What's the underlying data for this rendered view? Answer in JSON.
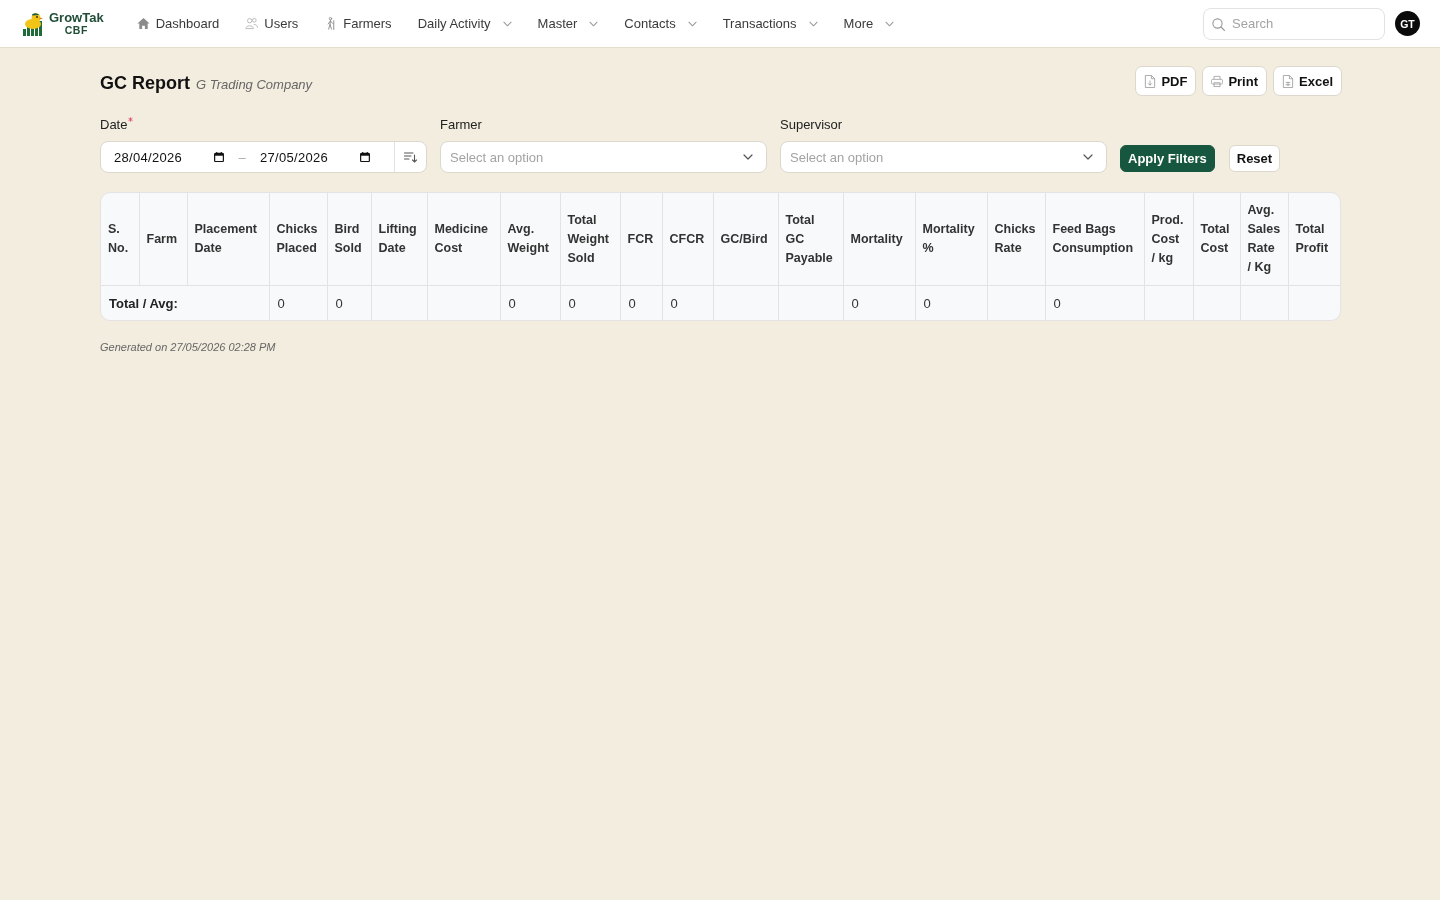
{
  "navbar": {
    "brand": {
      "name": "GrowTak",
      "tagline": "CBF"
    },
    "items": [
      {
        "label": "Dashboard",
        "kind": "link"
      },
      {
        "label": "Users",
        "kind": "link"
      },
      {
        "label": "Farmers",
        "kind": "link"
      },
      {
        "label": "Daily Activity",
        "kind": "menu"
      },
      {
        "label": "Master",
        "kind": "menu"
      },
      {
        "label": "Contacts",
        "kind": "menu"
      },
      {
        "label": "Transactions",
        "kind": "menu"
      },
      {
        "label": "More",
        "kind": "menu"
      }
    ],
    "search": {
      "placeholder": "Search"
    },
    "avatar": "GT"
  },
  "page": {
    "title": "GC Report",
    "subtitle": "G Trading Company",
    "exports": [
      "PDF",
      "Print",
      "Excel"
    ]
  },
  "filters": [
    {
      "kind": "date_range",
      "label": "Date",
      "required": true,
      "from": "28/04/2026",
      "separator": "–",
      "to": "27/05/2026"
    },
    {
      "kind": "select",
      "label": "Farmer",
      "required": false,
      "placeholder": "Select an option"
    },
    {
      "kind": "select",
      "label": "Supervisor",
      "required": false,
      "placeholder": "Select an option"
    }
  ],
  "actions": [
    {
      "label": "Apply Filters",
      "kind": "primary"
    },
    {
      "label": "Reset",
      "kind": "secondary"
    }
  ],
  "table": {
    "total_label": "Total / Avg:",
    "columns": [
      {
        "label": "S. No."
      },
      {
        "label": "Farm"
      },
      {
        "label": "Placement Date"
      },
      {
        "label": "Chicks Placed",
        "total": "0"
      },
      {
        "label": "Bird Sold",
        "total": "0"
      },
      {
        "label": "Lifting Date"
      },
      {
        "label": "Medicine Cost"
      },
      {
        "label": "Avg. Weight",
        "total": "0"
      },
      {
        "label": "Total Weight Sold",
        "total": "0"
      },
      {
        "label": "FCR",
        "total": "0"
      },
      {
        "label": "CFCR",
        "total": "0"
      },
      {
        "label": "GC/Bird"
      },
      {
        "label": "Total GC Payable"
      },
      {
        "label": "Mortality",
        "total": "0"
      },
      {
        "label": "Mortality %",
        "total": "0"
      },
      {
        "label": "Chicks Rate"
      },
      {
        "label": "Feed Bags Consumption",
        "total": "0"
      },
      {
        "label": "Prod. Cost / kg"
      },
      {
        "label": "Total Cost"
      },
      {
        "label": "Avg. Sales Rate / Kg"
      },
      {
        "label": "Total Profit"
      }
    ]
  },
  "generated": "Generated on 27/05/2026 02:28 PM"
}
